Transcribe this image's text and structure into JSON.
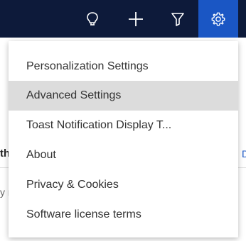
{
  "topbar": {
    "buttons": [
      {
        "icon": "lightbulb-icon"
      },
      {
        "icon": "plus-icon"
      },
      {
        "icon": "filter-icon"
      },
      {
        "icon": "gear-icon",
        "active": true
      }
    ],
    "background_color": "#0d1a3a",
    "active_color": "#1a56c4"
  },
  "background": {
    "fragment_left_1": "th",
    "fragment_left_2": "y n",
    "fragment_right_1": "D"
  },
  "settings_menu": {
    "items": [
      {
        "label": "Personalization Settings"
      },
      {
        "label": "Advanced Settings",
        "highlighted": true
      },
      {
        "label": "Toast Notification Display T..."
      },
      {
        "label": "About"
      },
      {
        "label": "Privacy & Cookies"
      },
      {
        "label": "Software license terms"
      }
    ],
    "highlight_color": "#dcdcdc"
  }
}
